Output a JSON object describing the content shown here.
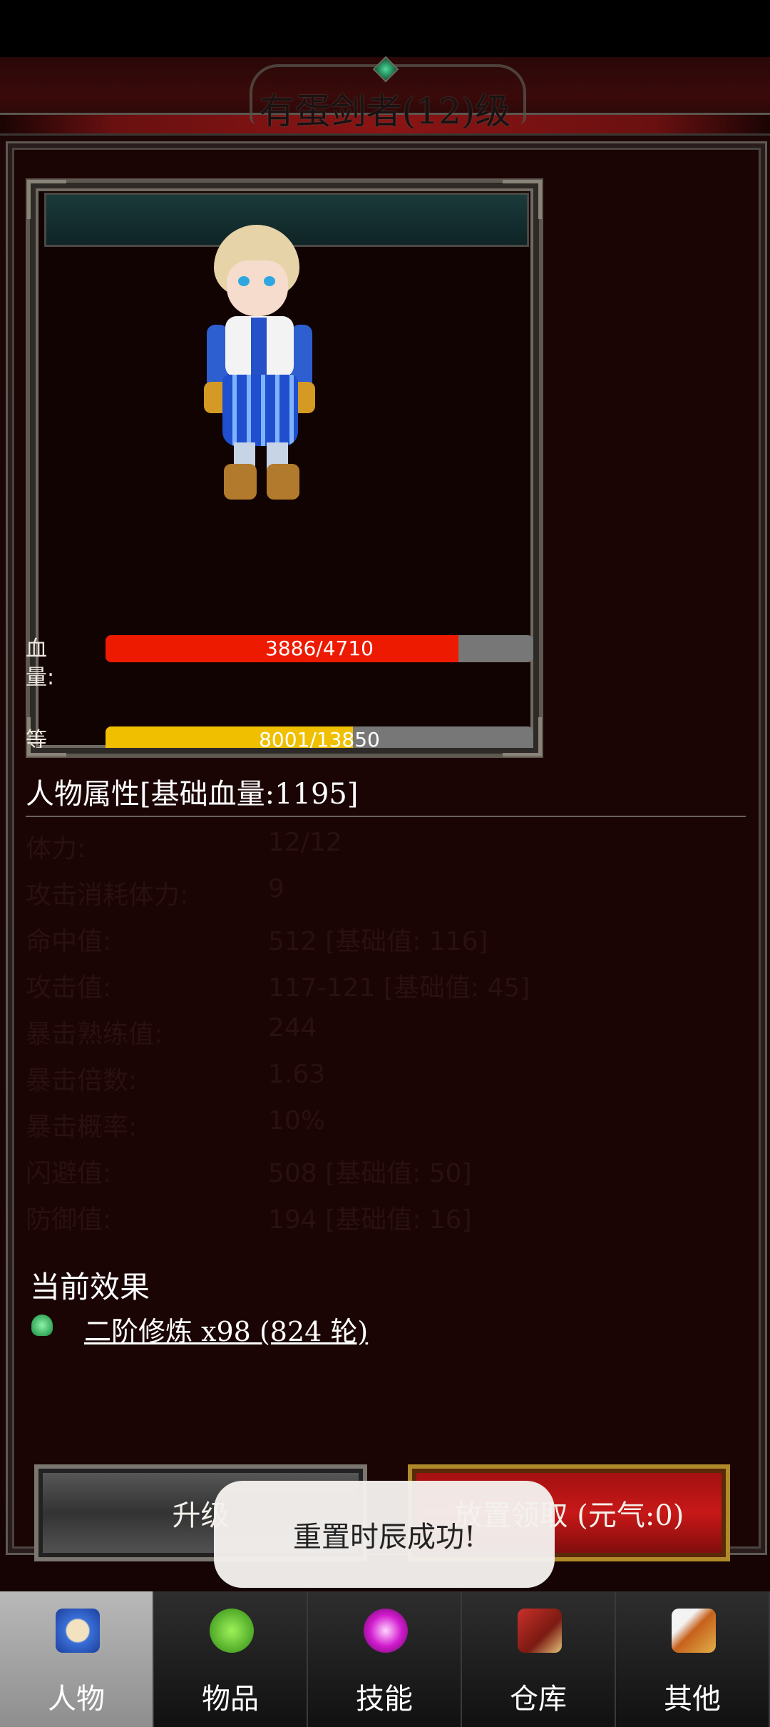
{
  "title": "有蛋剑者(12)级",
  "bars": {
    "hp": {
      "label": "血量:",
      "text": "3886/4710",
      "value": 3886,
      "max": 4710,
      "color": "#ee1a00"
    },
    "xp": {
      "label": "等级:",
      "text": "8001/13850",
      "value": 8001,
      "max": 13850,
      "color": "#f0c000"
    }
  },
  "attributes": {
    "header": "人物属性[基础血量:1195]",
    "rows": [
      {
        "key": "体力:",
        "value": "12/12"
      },
      {
        "key": "攻击消耗体力:",
        "value": "9"
      },
      {
        "key": "命中值:",
        "value": "512 [基础值: 116]"
      },
      {
        "key": "攻击值:",
        "value": "117-121 [基础值: 45]"
      },
      {
        "key": "暴击熟练值:",
        "value": "244"
      },
      {
        "key": "暴击倍数:",
        "value": "1.63"
      },
      {
        "key": "暴击概率:",
        "value": "10%"
      },
      {
        "key": "闪避值:",
        "value": "508 [基础值: 50]"
      },
      {
        "key": "防御值:",
        "value": "194 [基础值: 16]"
      }
    ]
  },
  "effects": {
    "title": "当前效果",
    "items": [
      {
        "label": "二阶修炼 x98 (824 轮)",
        "icon": "green-gem-icon"
      }
    ]
  },
  "buttons": {
    "upgrade": "升级",
    "collect": "放置领取 (元气:0)"
  },
  "toast": "重置时辰成功!",
  "nav": {
    "items": [
      {
        "label": "人物",
        "icon": "character-icon",
        "active": true
      },
      {
        "label": "物品",
        "icon": "potion-icon",
        "active": false
      },
      {
        "label": "技能",
        "icon": "skill-orb-icon",
        "active": false
      },
      {
        "label": "仓库",
        "icon": "warehouse-icon",
        "active": false
      },
      {
        "label": "其他",
        "icon": "sword-icon",
        "active": false
      }
    ]
  }
}
